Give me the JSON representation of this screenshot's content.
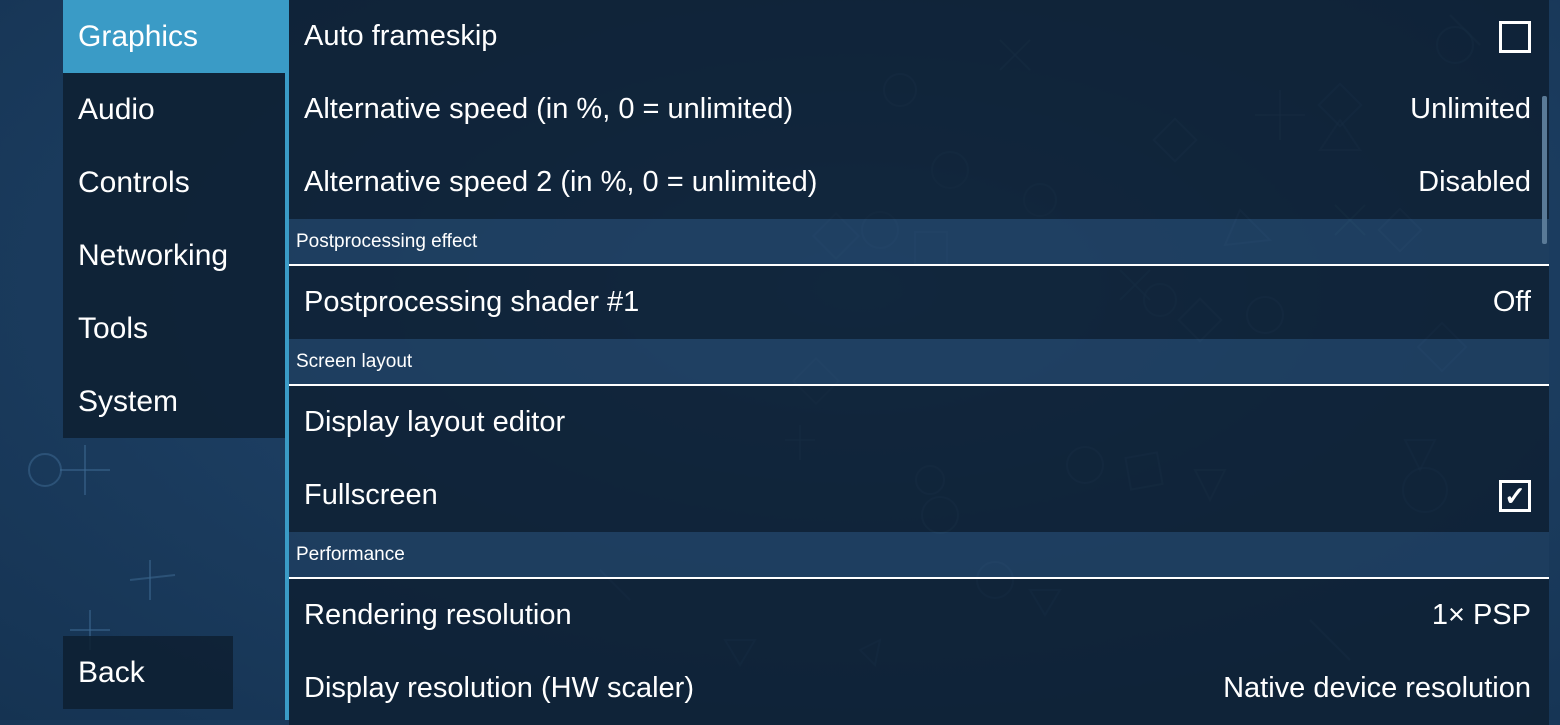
{
  "sidebar": {
    "tabs": [
      {
        "label": "Graphics",
        "active": true
      },
      {
        "label": "Audio"
      },
      {
        "label": "Controls"
      },
      {
        "label": "Networking"
      },
      {
        "label": "Tools"
      },
      {
        "label": "System"
      }
    ],
    "back_label": "Back"
  },
  "settings": {
    "auto_frameskip": {
      "label": "Auto frameskip",
      "checked": false
    },
    "alt_speed": {
      "label": "Alternative speed (in %, 0 = unlimited)",
      "value": "Unlimited"
    },
    "alt_speed2": {
      "label": "Alternative speed 2 (in %, 0 = unlimited)",
      "value": "Disabled"
    },
    "postprocessing_header": "Postprocessing effect",
    "shader1": {
      "label": "Postprocessing shader #1",
      "value": "Off"
    },
    "screen_layout_header": "Screen layout",
    "layout_editor": {
      "label": "Display layout editor"
    },
    "fullscreen": {
      "label": "Fullscreen",
      "checked": true,
      "mark": "✓"
    },
    "performance_header": "Performance",
    "rendering_res": {
      "label": "Rendering resolution",
      "value": "1× PSP"
    },
    "display_res": {
      "label": "Display resolution (HW scaler)",
      "value": "Native device resolution"
    }
  },
  "colors": {
    "accent": "#3a9bc6",
    "panel": "#0e2032",
    "background": "#1d3f63"
  }
}
